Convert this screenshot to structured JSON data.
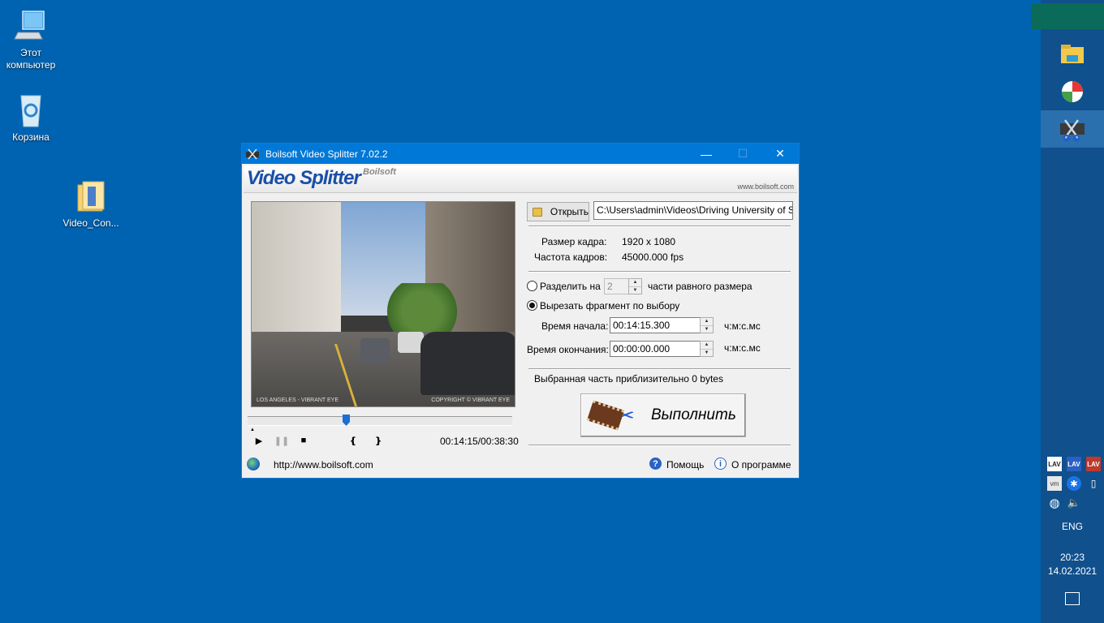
{
  "desktop": {
    "icons": [
      {
        "label": "Этот компьютер"
      },
      {
        "label": "Корзина"
      },
      {
        "label": "Video_Con..."
      }
    ]
  },
  "taskbar": {
    "tray_language": "ENG",
    "clock_time": "20:23",
    "clock_date": "14.02.2021",
    "tray_labels": [
      "LAV",
      "LAV",
      "LAV",
      "vm"
    ]
  },
  "window": {
    "title": "Boilsoft Video Splitter 7.02.2",
    "banner_logo": "Video Splitter",
    "banner_brand": "Boilsoft",
    "banner_url": "www.boilsoft.com",
    "video_overlay_left": "LOS ANGELES - VIBRANT EYE",
    "video_overlay_right": "COPYRIGHT © VIBRANT EYE",
    "timecode": "00:14:15/00:38:30",
    "seek_progress": 0.37,
    "open_button": "Открыть",
    "file_path": "C:\\Users\\admin\\Videos\\Driving University of South",
    "frame_size_label": "Размер кадра:",
    "frame_size_value": "1920 x 1080",
    "frame_rate_label": "Частота кадров:",
    "frame_rate_value": "45000.000 fps",
    "split_option_label": "Разделить на",
    "split_parts_value": "2",
    "split_suffix": "части равного размера",
    "cut_option_label": "Вырезать фрагмент по выбору",
    "start_time_label": "Время начала:",
    "start_time_value": "00:14:15.300",
    "end_time_label": "Время окончания:",
    "end_time_value": "00:00:00.000",
    "time_format": "ч:м:с.мс",
    "selection_size": "Выбранная часть приблизительно 0 bytes",
    "run_button": "Выполнить",
    "homepage_link": "http://www.boilsoft.com",
    "help_label": "Помощь",
    "about_label": "О программе"
  }
}
